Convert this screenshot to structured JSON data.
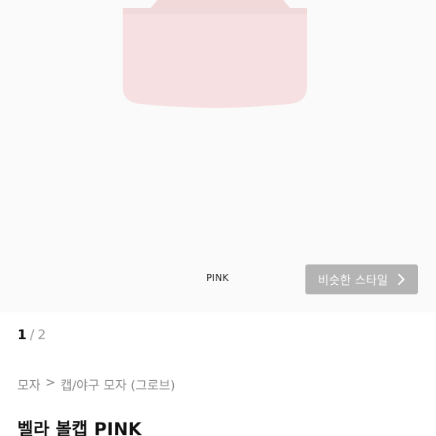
{
  "product_image": {
    "icon": "pink-cap-image",
    "color_hex": "#f6e0e1"
  },
  "color_label": "PINK",
  "similar_style_button": {
    "label": "비슷한 스타일",
    "icon": "chevron-right-icon"
  },
  "pager": {
    "current": "1",
    "separator": "/",
    "total": "2"
  },
  "breadcrumb": {
    "items": [
      "모자",
      "캡/야구 모자 (그로브)"
    ],
    "separator": ">"
  },
  "product": {
    "title": "벨라 볼캡 PINK"
  }
}
